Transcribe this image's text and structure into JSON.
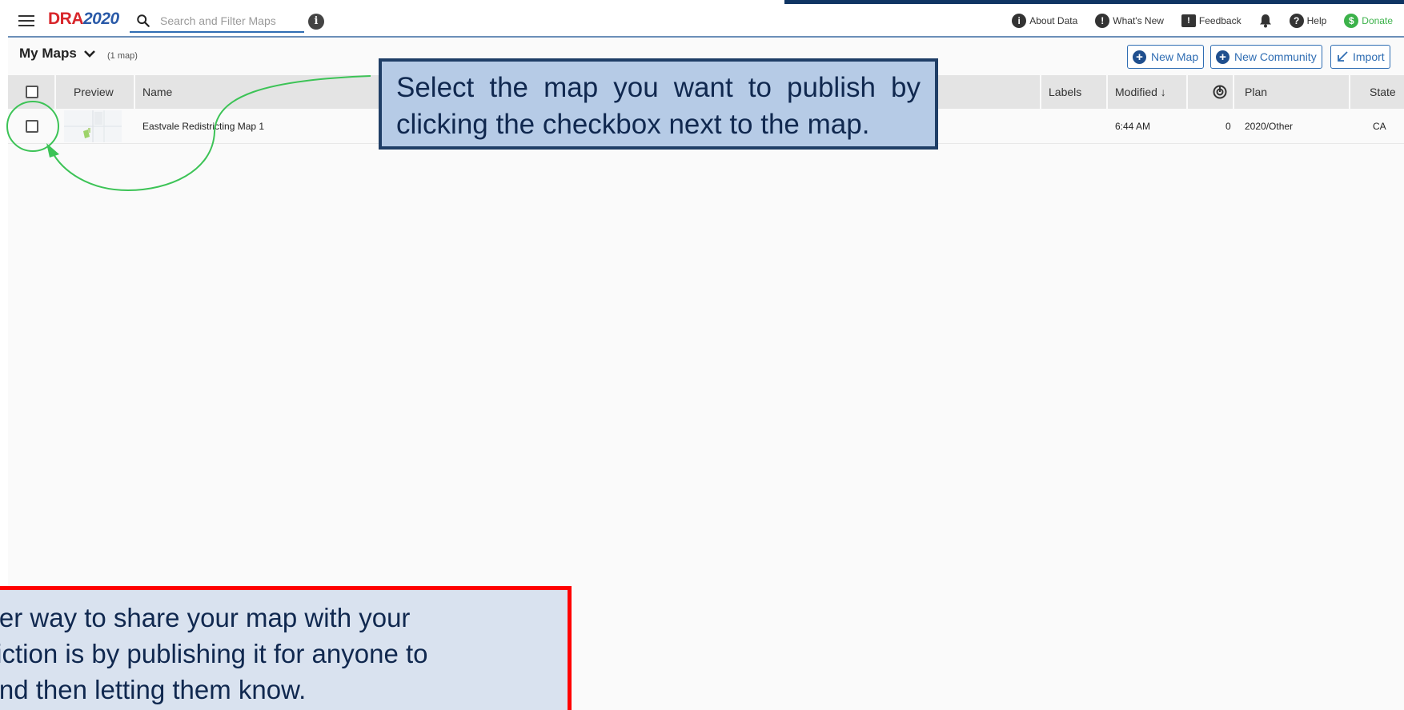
{
  "app": {
    "logo_dra": "DRA",
    "logo_year": "2020"
  },
  "search": {
    "placeholder": "Search and Filter Maps",
    "value": ""
  },
  "nav": {
    "about_data": "About Data",
    "whats_new": "What's New",
    "feedback": "Feedback",
    "help": "Help",
    "donate": "Donate"
  },
  "maps": {
    "title": "My Maps",
    "count": "(1 map)"
  },
  "buttons": {
    "new_map": "New Map",
    "new_community": "New Community",
    "import": "Import"
  },
  "table": {
    "headers": {
      "preview": "Preview",
      "name": "Name",
      "labels": "Labels",
      "modified": "Modified ↓",
      "plan": "Plan",
      "state": "State"
    },
    "rows": [
      {
        "name": "Eastvale Redistricting Map 1",
        "labels": "",
        "modified": "6:44 AM",
        "count": "0",
        "plan": "2020/Other",
        "state": "CA"
      }
    ]
  },
  "callouts": {
    "blue_text": "Select the map you want to publish by clicking the checkbox next to the map.",
    "red_line1": "other way to share your map with your",
    "red_line2": "isdiction is by publishing it for anyone to",
    "red_line3": "e and then letting them know."
  },
  "colors": {
    "accent": "#2f6db3",
    "logo_red": "#d8262b",
    "donate_green": "#3cb24a",
    "annotation_green": "#3cc356",
    "callout_border": "#1f3e66",
    "warning_border": "#ff0000"
  }
}
